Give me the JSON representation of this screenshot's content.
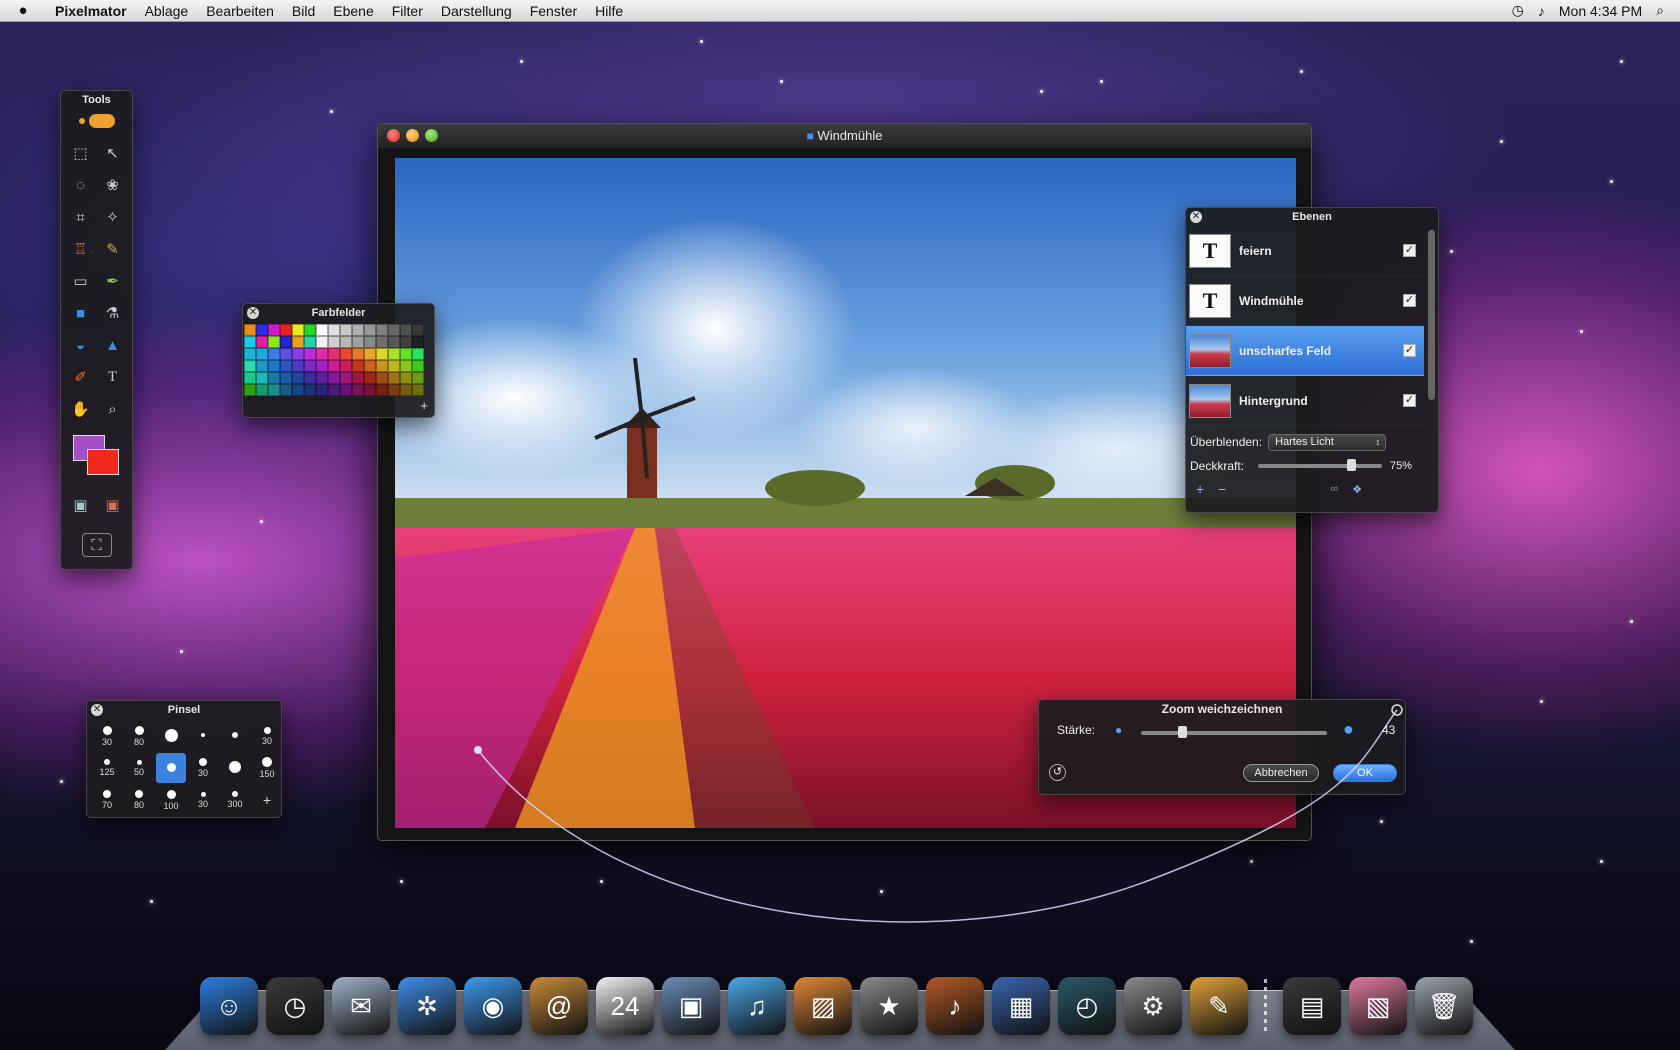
{
  "menubar": {
    "app_name": "Pixelmator",
    "items": [
      "Ablage",
      "Bearbeiten",
      "Bild",
      "Ebene",
      "Filter",
      "Darstellung",
      "Fenster",
      "Hilfe"
    ],
    "clock": "Mon 4:34 PM"
  },
  "tools_panel": {
    "title": "Tools",
    "colors": {
      "foreground": "#a44fc4",
      "background": "#ef2a1c"
    }
  },
  "image_window": {
    "title": "Windmühle"
  },
  "swatches_panel": {
    "title": "Farbfelder",
    "colors": [
      "#e98d1a",
      "#2d2ee8",
      "#d11ad0",
      "#e8231e",
      "#e8e81e",
      "#27d627",
      "#ffffff",
      "#e0e0e0",
      "#c8c8c8",
      "#b0b0b0",
      "#989898",
      "#808080",
      "#686868",
      "#505050",
      "#383838",
      "#1ec8e8",
      "#e01e9e",
      "#8be81e",
      "#2323d0",
      "#e8a21e",
      "#1ed6a2",
      "#f0f0f0",
      "#d0d0d0",
      "#b8b8b8",
      "#a0a0a0",
      "#888888",
      "#707070",
      "#585858",
      "#404040",
      "#202020",
      "#1eb4d6",
      "#1eaae0",
      "#3c7ce8",
      "#5a50e8",
      "#8e3ce8",
      "#b82ee0",
      "#e02ea8",
      "#e83070",
      "#e84a30",
      "#e8782a",
      "#e8a82a",
      "#d8d82a",
      "#a8e02a",
      "#62e02a",
      "#2ae062",
      "#2adcae",
      "#1e96c8",
      "#1e78c8",
      "#2a56c8",
      "#4a3ac8",
      "#7a2ac8",
      "#a81ec8",
      "#c81e98",
      "#c81e5a",
      "#c8321e",
      "#c8621e",
      "#c8921e",
      "#b8b81e",
      "#88c81e",
      "#3ec81e",
      "#1ec888",
      "#1eb8b8",
      "#1a7aa8",
      "#1a5ca8",
      "#22449e",
      "#3a2e9e",
      "#5e229e",
      "#86189e",
      "#9e1878",
      "#9e1848",
      "#9e2818",
      "#9e4e18",
      "#9e7418",
      "#909018",
      "#6a9e18",
      "#309e18",
      "#189e68",
      "#18908e",
      "#145e84",
      "#144684",
      "#1a347a",
      "#2c247a",
      "#481a7a",
      "#68127a",
      "#7a125c",
      "#7a1238",
      "#7a2012",
      "#7a3c12",
      "#7a5a12",
      "#6e6e12"
    ]
  },
  "brush_panel": {
    "title": "Pinsel",
    "brushes": [
      "30",
      "80",
      "",
      "",
      "",
      "30",
      "125",
      "50",
      "",
      "30",
      "",
      "150",
      "70",
      "80",
      "100",
      "30",
      "300"
    ]
  },
  "layers_panel": {
    "title": "Ebenen",
    "layers": [
      {
        "name": "feiern",
        "type": "text",
        "selected": false
      },
      {
        "name": "Windmühle",
        "type": "text",
        "selected": false
      },
      {
        "name": "unscharfes Feld",
        "type": "image",
        "selected": true
      },
      {
        "name": "Hintergrund",
        "type": "image",
        "selected": false
      }
    ],
    "blend_label": "Überblenden:",
    "blend_value": "Hartes Licht",
    "opacity_label": "Deckkraft:",
    "opacity_value": "75%",
    "opacity_level": 0.75
  },
  "zoom_blur_dialog": {
    "title": "Zoom weichzeichnen",
    "strength_label": "Stärke:",
    "strength_value": "43",
    "strength_level": 0.22,
    "cancel_label": "Abbrechen",
    "ok_label": "OK"
  },
  "dock": {
    "apps": [
      {
        "icon": "finder-icon",
        "glyph": "☺",
        "color": "#2f7fe0"
      },
      {
        "icon": "dashboard-icon",
        "glyph": "◷",
        "color": "#3a3a3a"
      },
      {
        "icon": "mail-icon",
        "glyph": "✉",
        "color": "#9fb3c9"
      },
      {
        "icon": "safari-icon",
        "glyph": "✲",
        "color": "#3f8ee8"
      },
      {
        "icon": "ichat-icon",
        "glyph": "◉",
        "color": "#3f9af0"
      },
      {
        "icon": "address-book-icon",
        "glyph": "@",
        "color": "#c88b3a"
      },
      {
        "icon": "ical-icon",
        "glyph": "24",
        "color": "#f2f2f2"
      },
      {
        "icon": "preview-icon",
        "glyph": "▣",
        "color": "#6a8eb8"
      },
      {
        "icon": "itunes-icon",
        "glyph": "♫",
        "color": "#4aa8e8"
      },
      {
        "icon": "iphoto-icon",
        "glyph": "▨",
        "color": "#e0893a"
      },
      {
        "icon": "imovie-icon",
        "glyph": "★",
        "color": "#8a8a8a"
      },
      {
        "icon": "garageband-icon",
        "glyph": "♪",
        "color": "#b35a28"
      },
      {
        "icon": "spaces-icon",
        "glyph": "▦",
        "color": "#3a66b0"
      },
      {
        "icon": "time-machine-icon",
        "glyph": "◴",
        "color": "#2a5a6a"
      },
      {
        "icon": "system-preferences-icon",
        "glyph": "⚙",
        "color": "#8a8a8a"
      },
      {
        "icon": "pixelmator-icon",
        "glyph": "✎",
        "color": "#e0a23a"
      }
    ],
    "stacks": [
      {
        "icon": "documents-stack-icon",
        "glyph": "▤",
        "color": "#3a3a3a"
      },
      {
        "icon": "pictures-stack-icon",
        "glyph": "▧",
        "color": "#e07aa0"
      },
      {
        "icon": "trash-icon",
        "glyph": "🗑",
        "color": "#9aa3ad"
      }
    ]
  }
}
